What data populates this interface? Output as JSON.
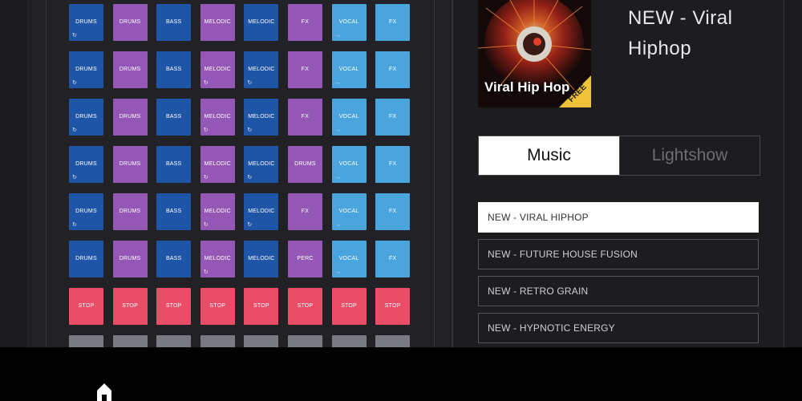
{
  "pads": [
    [
      {
        "label": "DRUMS",
        "color": "c-drums-dark",
        "icon": "loop-icon"
      },
      {
        "label": "DRUMS",
        "color": "c-drums-purple",
        "icon": ""
      },
      {
        "label": "BASS",
        "color": "c-bass",
        "icon": ""
      },
      {
        "label": "MELODIC",
        "color": "c-melodic",
        "icon": ""
      },
      {
        "label": "MELODIC",
        "color": "c-melodic-blue",
        "icon": ""
      },
      {
        "label": "FX",
        "color": "c-fx-purple",
        "icon": ""
      },
      {
        "label": "VOCAL",
        "color": "c-vocal",
        "icon": "arrow-icon"
      },
      {
        "label": "FX",
        "color": "c-fx-blue",
        "icon": ""
      }
    ],
    [
      {
        "label": "DRUMS",
        "color": "c-drums-dark",
        "icon": "loop-icon"
      },
      {
        "label": "DRUMS",
        "color": "c-drums-purple",
        "icon": ""
      },
      {
        "label": "BASS",
        "color": "c-bass",
        "icon": ""
      },
      {
        "label": "MELODIC",
        "color": "c-melodic",
        "icon": "loop-icon"
      },
      {
        "label": "MELODIC",
        "color": "c-melodic-blue",
        "icon": "loop-icon"
      },
      {
        "label": "FX",
        "color": "c-fx-purple",
        "icon": ""
      },
      {
        "label": "VOCAL",
        "color": "c-vocal",
        "icon": "arrow-icon"
      },
      {
        "label": "FX",
        "color": "c-fx-blue",
        "icon": ""
      }
    ],
    [
      {
        "label": "DRUMS",
        "color": "c-drums-dark",
        "icon": "loop-icon"
      },
      {
        "label": "DRUMS",
        "color": "c-drums-purple",
        "icon": ""
      },
      {
        "label": "BASS",
        "color": "c-bass",
        "icon": ""
      },
      {
        "label": "MELODIC",
        "color": "c-melodic",
        "icon": "loop-icon"
      },
      {
        "label": "MELODIC",
        "color": "c-melodic-blue",
        "icon": "loop-icon"
      },
      {
        "label": "FX",
        "color": "c-fx-purple",
        "icon": ""
      },
      {
        "label": "VOCAL",
        "color": "c-vocal",
        "icon": "arrow-icon"
      },
      {
        "label": "FX",
        "color": "c-fx-blue",
        "icon": ""
      }
    ],
    [
      {
        "label": "DRUMS",
        "color": "c-drums-dark",
        "icon": "loop-icon"
      },
      {
        "label": "DRUMS",
        "color": "c-drums-purple",
        "icon": ""
      },
      {
        "label": "BASS",
        "color": "c-bass",
        "icon": ""
      },
      {
        "label": "MELODIC",
        "color": "c-melodic",
        "icon": "loop-icon"
      },
      {
        "label": "MELODIC",
        "color": "c-melodic-blue",
        "icon": "loop-icon"
      },
      {
        "label": "DRUMS",
        "color": "c-fx-purple",
        "icon": ""
      },
      {
        "label": "VOCAL",
        "color": "c-vocal",
        "icon": "arrow-icon"
      },
      {
        "label": "FX",
        "color": "c-fx-blue",
        "icon": ""
      }
    ],
    [
      {
        "label": "DRUMS",
        "color": "c-drums-dark",
        "icon": "loop-icon"
      },
      {
        "label": "DRUMS",
        "color": "c-drums-purple",
        "icon": ""
      },
      {
        "label": "BASS",
        "color": "c-bass",
        "icon": ""
      },
      {
        "label": "MELODIC",
        "color": "c-melodic",
        "icon": "loop-icon"
      },
      {
        "label": "MELODIC",
        "color": "c-melodic-blue",
        "icon": "loop-icon"
      },
      {
        "label": "FX",
        "color": "c-fx-purple",
        "icon": ""
      },
      {
        "label": "VOCAL",
        "color": "c-vocal",
        "icon": "arrow-icon"
      },
      {
        "label": "FX",
        "color": "c-fx-blue",
        "icon": ""
      }
    ],
    [
      {
        "label": "DRUMS",
        "color": "c-drums-dark",
        "icon": ""
      },
      {
        "label": "DRUMS",
        "color": "c-drums-purple",
        "icon": ""
      },
      {
        "label": "BASS",
        "color": "c-bass",
        "icon": ""
      },
      {
        "label": "MELODIC",
        "color": "c-melodic",
        "icon": "loop-icon"
      },
      {
        "label": "MELODIC",
        "color": "c-melodic-blue",
        "icon": ""
      },
      {
        "label": "PERC",
        "color": "c-fx-purple",
        "icon": ""
      },
      {
        "label": "VOCAL",
        "color": "c-vocal",
        "icon": "arrow-icon"
      },
      {
        "label": "FX",
        "color": "c-fx-blue",
        "icon": ""
      }
    ],
    [
      {
        "label": "STOP",
        "color": "c-stop",
        "icon": ""
      },
      {
        "label": "STOP",
        "color": "c-stop",
        "icon": ""
      },
      {
        "label": "STOP",
        "color": "c-stop",
        "icon": ""
      },
      {
        "label": "STOP",
        "color": "c-stop",
        "icon": ""
      },
      {
        "label": "STOP",
        "color": "c-stop",
        "icon": ""
      },
      {
        "label": "STOP",
        "color": "c-stop",
        "icon": ""
      },
      {
        "label": "STOP",
        "color": "c-stop",
        "icon": ""
      },
      {
        "label": "STOP",
        "color": "c-stop",
        "icon": ""
      }
    ],
    [
      {
        "label": "",
        "color": "c-empty",
        "icon": ""
      },
      {
        "label": "",
        "color": "c-empty",
        "icon": ""
      },
      {
        "label": "",
        "color": "c-empty",
        "icon": ""
      },
      {
        "label": "",
        "color": "c-empty",
        "icon": ""
      },
      {
        "label": "",
        "color": "c-empty",
        "icon": ""
      },
      {
        "label": "",
        "color": "c-empty",
        "icon": ""
      },
      {
        "label": "",
        "color": "c-empty",
        "icon": ""
      },
      {
        "label": "",
        "color": "c-empty",
        "icon": ""
      }
    ]
  ],
  "cover": {
    "text": "Viral Hip Hop",
    "badge": "FREE"
  },
  "track_title": "NEW - Viral Hiphop",
  "tabs": {
    "music": "Music",
    "lightshow": "Lightshow"
  },
  "playlist": [
    {
      "label": "NEW - VIRAL HIPHOP",
      "selected": true
    },
    {
      "label": "NEW - FUTURE HOUSE FUSION",
      "selected": false
    },
    {
      "label": "NEW - RETRO GRAIN",
      "selected": false
    },
    {
      "label": "NEW - HYPNOTIC ENERGY",
      "selected": false
    }
  ],
  "colors": {
    "drums_dark": "#1f55a6",
    "purple": "#9457b5",
    "light_blue": "#4aa5df",
    "stop": "#ea4d67",
    "empty": "#7a7b82"
  }
}
